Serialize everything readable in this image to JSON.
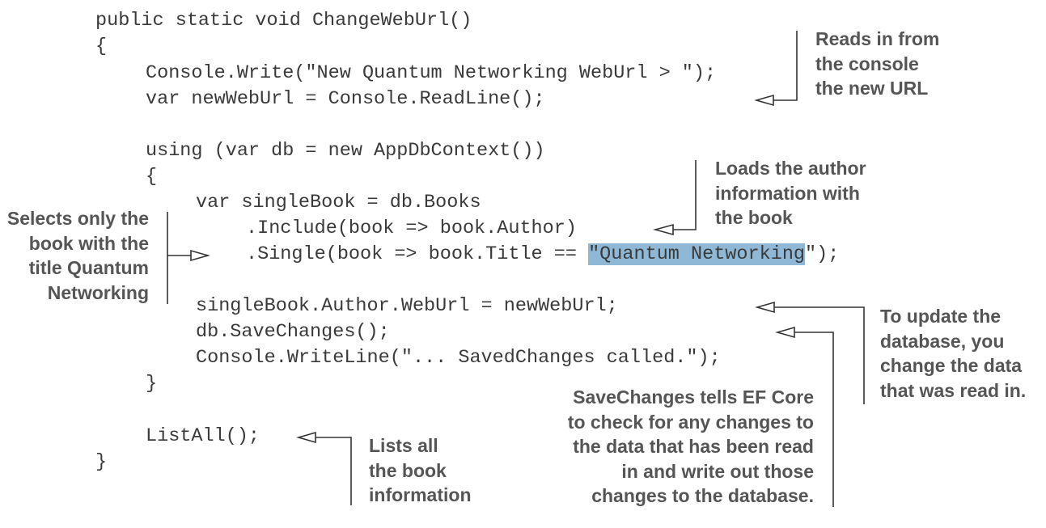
{
  "code_lines": [
    "public static void ChangeWebUrl()",
    "{",
    "Console.Write(\"New Quantum Networking WebUrl > \");",
    "var newWebUrl = Console.ReadLine();",
    "using (var db = new AppDbContext())",
    "{",
    "var singleBook = db.Books",
    ".Include(book => book.Author)",
    {
      "pre": ".Single(book => book.Title == ",
      "highlight": "\"Quantum Networking",
      "post": "\");"
    },
    "singleBook.Author.WebUrl = newWebUrl;",
    "db.SaveChanges();",
    "Console.WriteLine(\"... SavedChanges called.\");",
    "}",
    "ListAll();",
    "}"
  ],
  "annotations": {
    "reads_console": [
      "Reads in from",
      "the console",
      "the new URL"
    ],
    "loads_author": [
      "Loads the author",
      "information with",
      "the book"
    ],
    "selects_book": [
      "Selects only the",
      "book with the",
      "title Quantum",
      "Networking"
    ],
    "to_update": [
      "To update the",
      "database, you",
      "change the data",
      "that was read in."
    ],
    "savechanges": [
      "SaveChanges tells EF Core",
      "to check for any changes to",
      "the data that has been read",
      "in and write out those",
      "changes to the database."
    ],
    "lists_all": [
      "Lists all",
      "the book",
      "information"
    ]
  },
  "colors": {
    "code_text": "#3a3a3a",
    "annotation_text": "#555555",
    "highlight": "#8fb8d6",
    "arrow": "#333333"
  }
}
